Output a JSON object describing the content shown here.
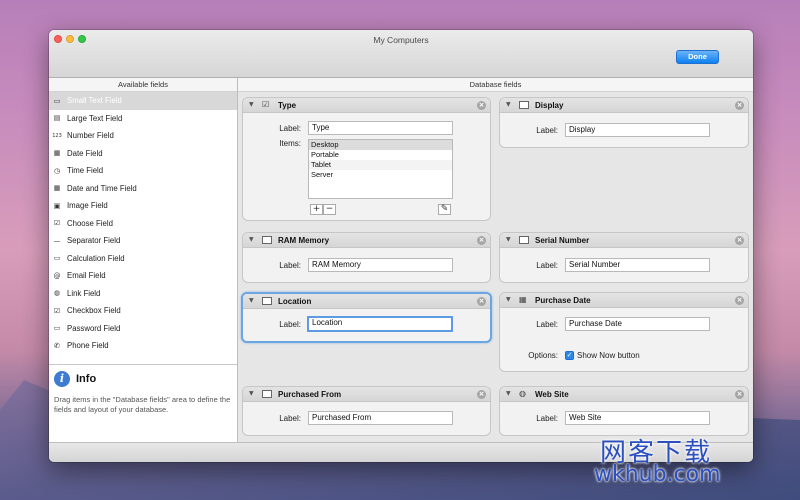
{
  "window": {
    "title": "My Computers",
    "done_label": "Done"
  },
  "sidebar": {
    "header": "Available fields",
    "items": [
      {
        "label": "Small Text Field",
        "icon": "small-text-field-icon",
        "glyph": "▭",
        "selected": true
      },
      {
        "label": "Large Text Field",
        "icon": "large-text-field-icon",
        "glyph": "▤"
      },
      {
        "label": "Number Field",
        "icon": "number-field-icon",
        "glyph": "123"
      },
      {
        "label": "Date Field",
        "icon": "date-field-icon",
        "glyph": "▦"
      },
      {
        "label": "Time Field",
        "icon": "time-field-icon",
        "glyph": "◷"
      },
      {
        "label": "Date and Time Field",
        "icon": "date-time-field-icon",
        "glyph": "▦"
      },
      {
        "label": "Image Field",
        "icon": "image-field-icon",
        "glyph": "▣"
      },
      {
        "label": "Choose Field",
        "icon": "choose-field-icon",
        "glyph": "☑"
      },
      {
        "label": "Separator Field",
        "icon": "separator-field-icon",
        "glyph": "—"
      },
      {
        "label": "Calculation Field",
        "icon": "calculation-field-icon",
        "glyph": "▭"
      },
      {
        "label": "Email Field",
        "icon": "email-field-icon",
        "glyph": "@"
      },
      {
        "label": "Link Field",
        "icon": "link-field-icon",
        "glyph": "◍"
      },
      {
        "label": "Checkbox Field",
        "icon": "checkbox-field-icon",
        "glyph": "☑"
      },
      {
        "label": "Password Field",
        "icon": "password-field-icon",
        "glyph": "▭"
      },
      {
        "label": "Phone Field",
        "icon": "phone-field-icon",
        "glyph": "✆"
      }
    ],
    "info": {
      "title": "Info",
      "icon_glyph": "i",
      "text": "Drag items in the \"Database fields\" area to define the fields and layout of your database."
    }
  },
  "main": {
    "header": "Database fields",
    "label_text": "Label:",
    "items_text": "Items:",
    "options_text": "Options:",
    "cards": {
      "type": {
        "title": "Type",
        "value": "Type",
        "items": [
          "Desktop",
          "Portable",
          "Tablet",
          "Server"
        ]
      },
      "display": {
        "title": "Display",
        "value": "Display"
      },
      "ram": {
        "title": "RAM Memory",
        "value": "RAM Memory"
      },
      "serial": {
        "title": "Serial Number",
        "value": "Serial Number"
      },
      "location": {
        "title": "Location",
        "value": "Location"
      },
      "purchase_date": {
        "title": "Purchase Date",
        "value": "Purchase Date",
        "option": "Show Now button",
        "option_checked": true
      },
      "purchased_from": {
        "title": "Purchased From",
        "value": "Purchased From"
      },
      "website": {
        "title": "Web Site",
        "value": "Web Site"
      }
    }
  },
  "watermark": {
    "cn": "网客下载",
    "en": "wkhub.com"
  },
  "colors": {
    "accent": "#2d88ec",
    "selection": "#d8d8d8",
    "focus_ring": "#6ca6e0"
  }
}
